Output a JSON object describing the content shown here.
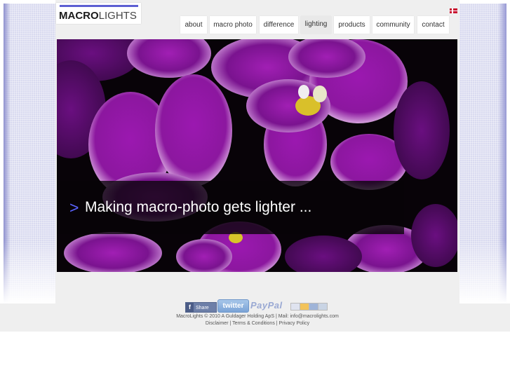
{
  "brand": {
    "logo_bold": "MACRO",
    "logo_light": "LIGHTS",
    "accent_color": "#5d5fd2"
  },
  "language_flag": "danish-flag",
  "nav": {
    "items": [
      {
        "label": "about"
      },
      {
        "label": "macro photo"
      },
      {
        "label": "difference"
      },
      {
        "label": "lighting"
      },
      {
        "label": "products"
      },
      {
        "label": "community"
      },
      {
        "label": "contact"
      }
    ],
    "active": "lighting"
  },
  "hero": {
    "arrow": ">",
    "caption": "Making macro-photo gets lighter ..."
  },
  "social": {
    "facebook_icon": "f",
    "facebook_label": "Share",
    "twitter_label": "twitter",
    "paypal_label": "PayPal",
    "cards_icon": "credit-cards-icon"
  },
  "footer": {
    "company": "MacroLights © 2010 A Guldager Holding ApS",
    "sep1": " | ",
    "mail": "Mail: info@macrolights.com",
    "disclaimer": "Disclaimer",
    "sep2": " | ",
    "terms": "Terms & Conditions",
    "sep3": " | ",
    "privacy": "Privacy Policy"
  }
}
